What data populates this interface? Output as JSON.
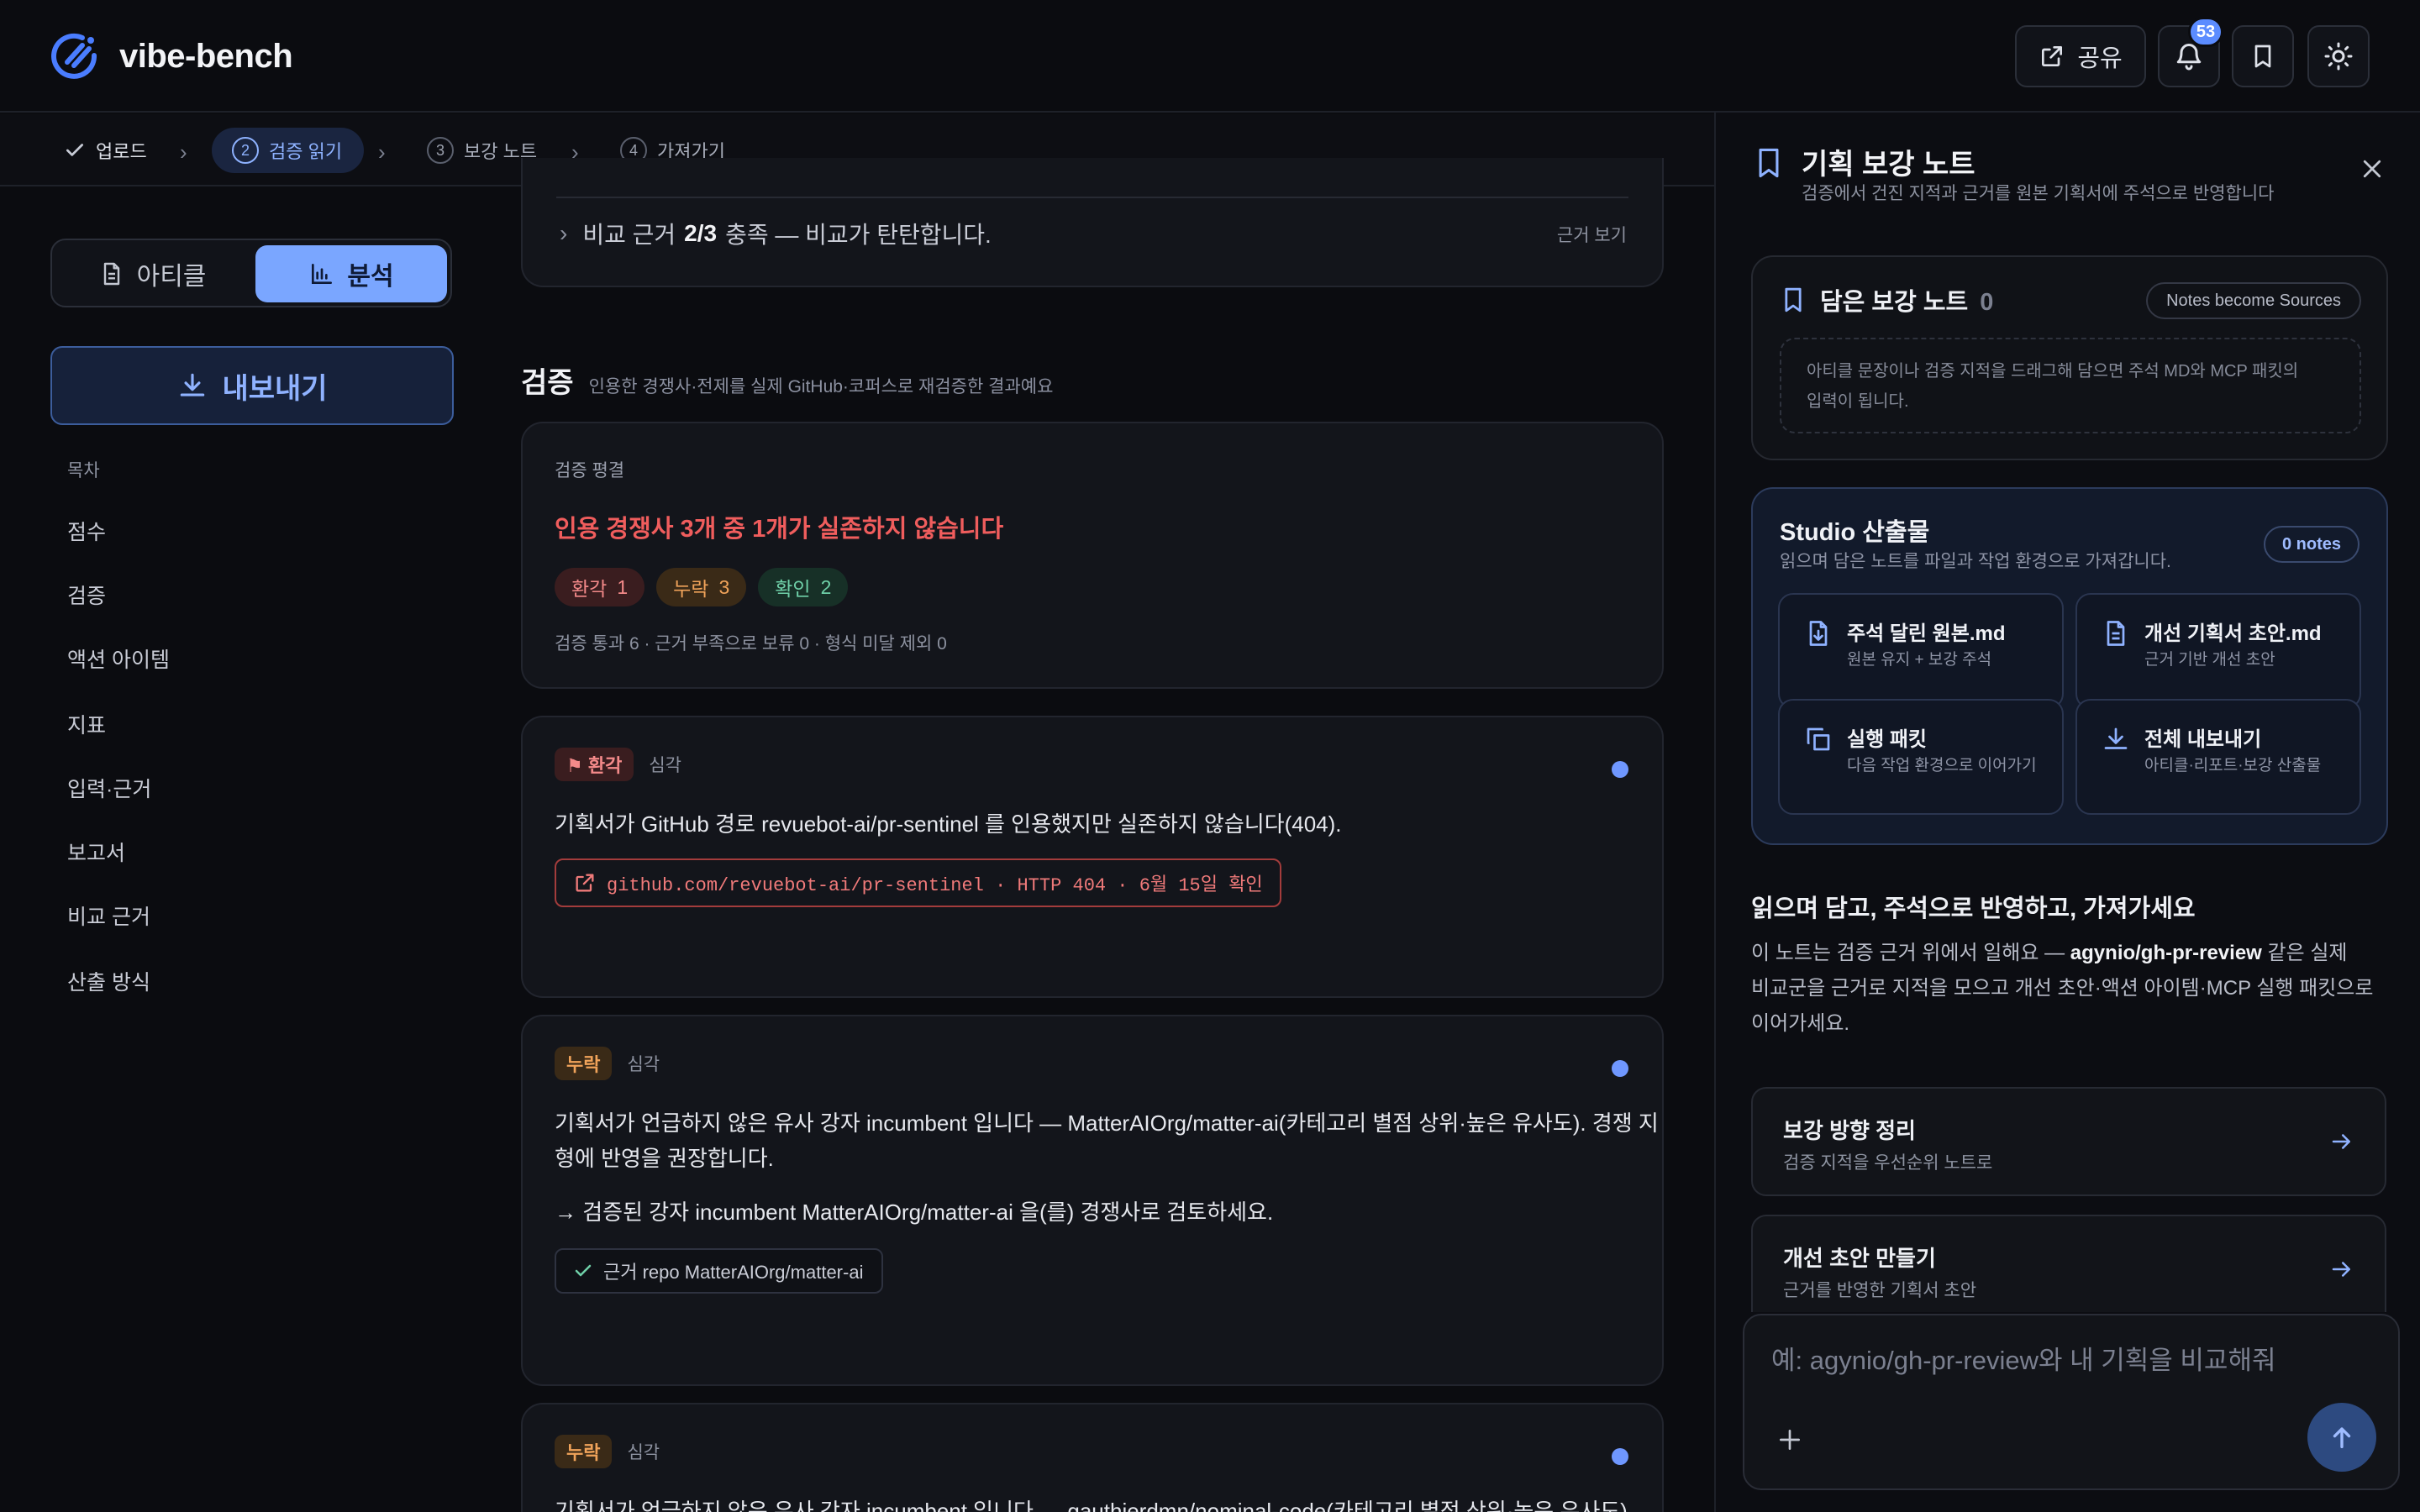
{
  "header": {
    "app_name": "vibe-bench",
    "share_label": "공유",
    "notification_count": "53"
  },
  "stepper": {
    "steps": [
      {
        "num": "",
        "label": "업로드",
        "state": "done"
      },
      {
        "num": "2",
        "label": "검증 읽기",
        "state": "active"
      },
      {
        "num": "3",
        "label": "보강 노트",
        "state": "todo"
      },
      {
        "num": "4",
        "label": "가져가기",
        "state": "todo"
      }
    ]
  },
  "sidebar": {
    "tabs": [
      "아티클",
      "분석"
    ],
    "active_tab": "분석",
    "export_label": "내보내기",
    "toc_label": "목차",
    "toc": [
      "점수",
      "검증",
      "액션 아이템",
      "지표",
      "입력·근거",
      "보고서",
      "비교 근거",
      "산출 방식"
    ]
  },
  "main": {
    "comparison": {
      "text_prefix": "비교 근거",
      "ratio": "2/3",
      "text_suffix": "충족 — 비교가 탄탄합니다.",
      "link": "근거 보기"
    },
    "section": {
      "title": "검증",
      "subtitle": "인용한 경쟁사·전제를 실제 GitHub·코퍼스로 재검증한 결과예요"
    },
    "verdict": {
      "label": "검증 평결",
      "headline": "인용 경쟁사 3개 중 1개가 실존하지 않습니다",
      "pills": [
        {
          "label": "환각",
          "count": "1"
        },
        {
          "label": "누락",
          "count": "3"
        },
        {
          "label": "확인",
          "count": "2"
        }
      ],
      "summary": "검증 통과 6 · 근거 부족으로 보류 0 · 형식 미달 제외 0"
    },
    "issues": [
      {
        "tag": "⚑ 환각",
        "severity": "심각",
        "text": "기획서가 GitHub 경로 revuebot-ai/pr-sentinel 를 인용했지만 실존하지 않습니다(404).",
        "evidence": "github.com/revuebot-ai/pr-sentinel · HTTP 404 · 6월 15일 확인"
      },
      {
        "tag": "누락",
        "severity": "심각",
        "text_line1": "기획서가 언급하지 않은 유사 강자 incumbent 입니다 — MatterAIOrg/matter-ai(카테고리 별점 상위·높은 유사도). 경쟁 지",
        "text_line2": "형에 반영을 권장합니다.",
        "recommendation": "→ 검증된 강자 incumbent MatterAIOrg/matter-ai 을(를) 경쟁사로 검토하세요.",
        "evidence": "근거 repo MatterAIOrg/matter-ai"
      },
      {
        "tag": "누락",
        "severity": "심각",
        "text": "기획서가 언급하지 않은 유사 강자 incumbent 입니다 — gauthierdmn/nominal-code(카테고리 별점 상위·높은 유사도). 경"
      }
    ]
  },
  "notes_panel": {
    "title": "기획 보강 노트",
    "subtitle": "검증에서 건진 지적과 근거를 원본 기획서에 주석으로 반영합니다",
    "saved": {
      "title": "담은 보강 노트",
      "count": "0",
      "chip": "Notes become Sources",
      "hint_line1": "아티클 문장이나 검증 지적을 드래그해 담으면 주석 MD와 MCP 패킷의",
      "hint_line2": "입력이 됩니다."
    },
    "studio": {
      "title": "Studio 산출물",
      "subtitle": "읽으며 담은 노트를 파일과 작업 환경으로 가져갑니다.",
      "chip": "0 notes",
      "tiles": [
        {
          "title": "주석 달린 원본.md",
          "desc": "원본 유지 + 보강 주석",
          "icon": "file-download-icon"
        },
        {
          "title": "개선 기획서 초안.md",
          "desc": "근거 기반 개선 초안",
          "icon": "file-text-icon"
        },
        {
          "title": "실행 패킷",
          "desc": "다음 작업 환경으로 이어가기",
          "icon": "copy-icon"
        },
        {
          "title": "전체 내보내기",
          "desc": "아티클·리포트·보강 산출물",
          "icon": "download-icon"
        }
      ]
    },
    "intro": {
      "heading": "읽으며 담고, 주석으로 반영하고, 가져가세요",
      "body_prefix": "이 노트는 검증 근거 위에서 일해요 — ",
      "body_bold": "agynio/gh-pr-review",
      "body_suffix_line1": " 같은 실제",
      "body_line2": "비교군을 근거로 지적을 모으고 개선 초안·액션 아이템·MCP 실행 패킷으로",
      "body_line3": "이어가세요."
    },
    "actions": [
      {
        "title": "보강 방향 정리",
        "desc": "검증 지적을 우선순위 노트로"
      },
      {
        "title": "개선 초안 만들기",
        "desc": "근거를 반영한 기획서 초안"
      }
    ],
    "composer": {
      "placeholder": "예: agynio/gh-pr-review와 내 기획을 비교해줘"
    }
  },
  "colors": {
    "accent": "#7aa6ff",
    "danger": "#f05d5d",
    "warning": "#f0a35a",
    "success": "#6fd0a8"
  }
}
